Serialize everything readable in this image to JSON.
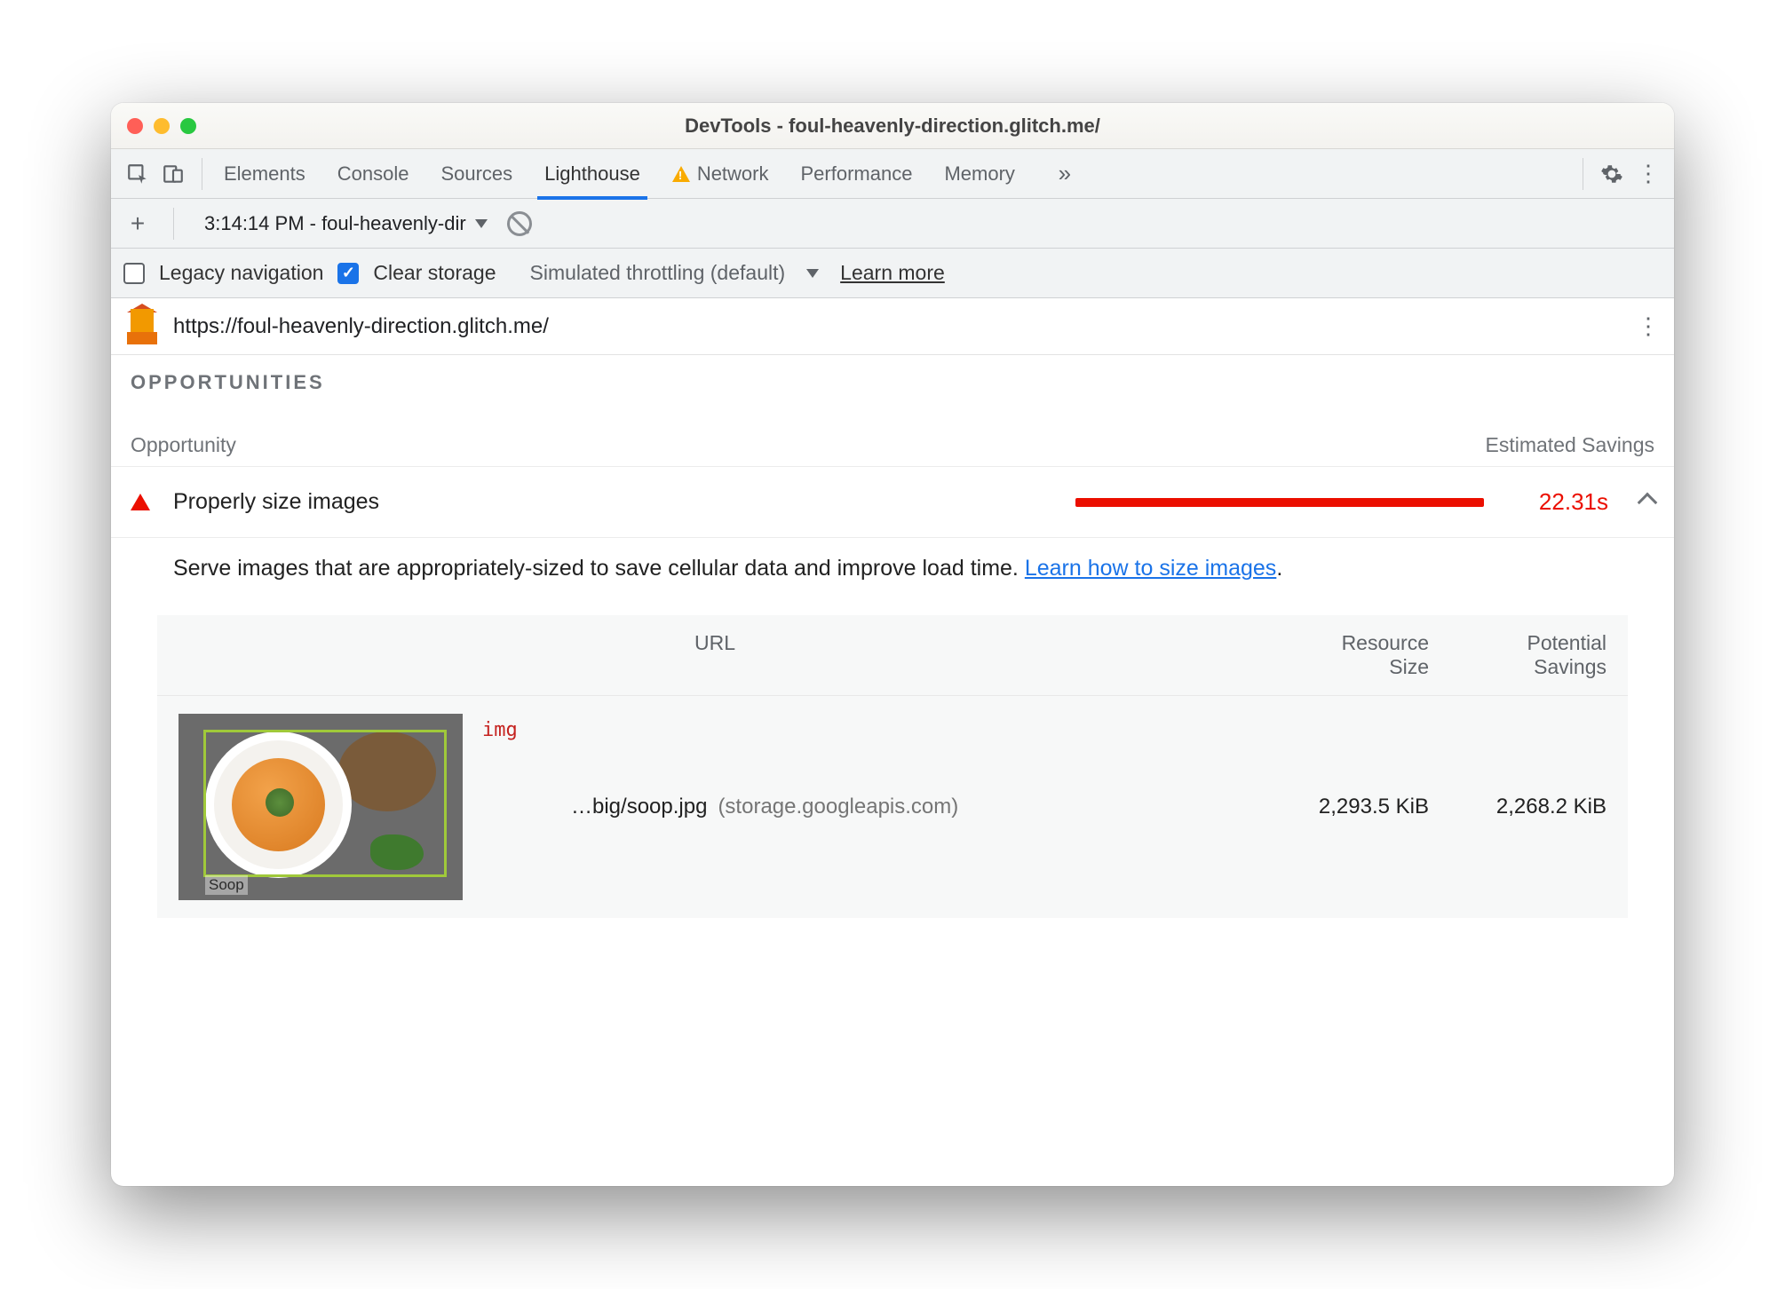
{
  "window": {
    "title": "DevTools - foul-heavenly-direction.glitch.me/"
  },
  "tabs": {
    "items": [
      "Elements",
      "Console",
      "Sources",
      "Lighthouse",
      "Network",
      "Performance",
      "Memory"
    ],
    "active": "Lighthouse",
    "warning_on": "Network"
  },
  "toolbar2": {
    "dropdown": "3:14:14 PM - foul-heavenly-dir"
  },
  "toolbar3": {
    "legacy_label": "Legacy navigation",
    "clear_label": "Clear storage",
    "throttling": "Simulated throttling (default)",
    "learn": "Learn more"
  },
  "urlrow": {
    "url": "https://foul-heavenly-direction.glitch.me/"
  },
  "section": {
    "title": "OPPORTUNITIES",
    "col_opportunity": "Opportunity",
    "col_savings": "Estimated Savings"
  },
  "opportunity": {
    "label": "Properly size images",
    "savings": "22.31s"
  },
  "description": {
    "text": "Serve images that are appropriately-sized to save cellular data and improve load time. ",
    "link": "Learn how to size images",
    "suffix": "."
  },
  "table": {
    "col_url": "URL",
    "col_resource_l1": "Resource",
    "col_resource_l2": "Size",
    "col_potential_l1": "Potential",
    "col_potential_l2": "Savings",
    "row": {
      "tag": "img",
      "thumb_caption": "Soop",
      "url_path": "…big/soop.jpg",
      "url_host": "(storage.googleapis.com)",
      "resource_size": "2,293.5 KiB",
      "potential_savings": "2,268.2 KiB"
    }
  }
}
